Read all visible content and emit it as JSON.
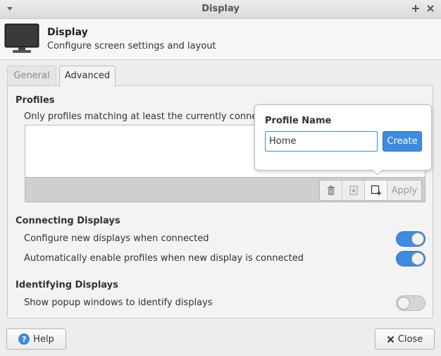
{
  "window": {
    "title": "Display"
  },
  "header": {
    "title": "Display",
    "subtitle": "Configure screen settings and layout",
    "icon": "monitor-icon"
  },
  "tabs": [
    {
      "label": "General",
      "active": false
    },
    {
      "label": "Advanced",
      "active": true
    }
  ],
  "profiles": {
    "title": "Profiles",
    "description": "Only profiles matching at least the currently connected disp",
    "toolbar": {
      "delete_icon": "trash-icon",
      "save_icon": "download-icon",
      "new_icon": "new-profile-icon",
      "apply_label": "Apply"
    }
  },
  "popover": {
    "title": "Profile Name",
    "input_value": "Home",
    "create_label": "Create"
  },
  "connecting": {
    "title": "Connecting Displays",
    "items": [
      {
        "label": "Configure new displays when connected",
        "enabled": true
      },
      {
        "label": "Automatically enable profiles when new display is connected",
        "enabled": true
      }
    ]
  },
  "identifying": {
    "title": "Identifying Displays",
    "items": [
      {
        "label": "Show popup windows to identify displays",
        "enabled": false
      }
    ]
  },
  "footer": {
    "help_label": "Help",
    "close_label": "Close"
  },
  "colors": {
    "accent": "#3d8be0",
    "background": "#ededed"
  }
}
